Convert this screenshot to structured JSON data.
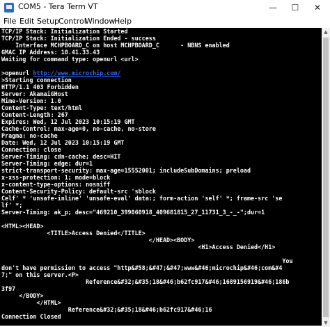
{
  "window": {
    "title": "COM5 - Tera Term VT",
    "minimize_glyph": "—",
    "maximize_glyph": "☐",
    "close_glyph": "✕"
  },
  "menu": {
    "items": [
      "File",
      "Edit",
      "Setup",
      "Control",
      "Window",
      "Help"
    ]
  },
  "terminal": {
    "lines": [
      "TCP/IP Stack: Initialization Started",
      "TCP/IP Stack: Initialization Ended - success",
      "    Interface MCHPBOARD_C on host MCHPBOARD_C      - NBNS enabled",
      "GMAC IP Address: 10.41.33.43",
      "Waiting for command type: openurl <url>",
      "",
      ">openurl http://www.microchip.com/",
      ">Starting connection",
      "HTTP/1.1 403 Forbidden",
      "Server: AkamaiGHost",
      "Mime-Version: 1.0",
      "Content-Type: text/html",
      "Content-Length: 267",
      "Expires: Wed, 12 Jul 2023 10:15:19 GMT",
      "Cache-Control: max-age=0, no-cache, no-store",
      "Pragma: no-cache",
      "Date: Wed, 12 Jul 2023 10:15:19 GMT",
      "Connection: close",
      "Server-Timing: cdn-cache; desc=HIT",
      "Server-Timing: edge; dur=1",
      "strict-transport-security: max-age=15552001; includeSubDomains; preload",
      "x-xss-protection: 1; mode=block",
      "x-content-type-options: nosniff",
      "Content-Security-Policy: default-src 'sblock",
      "Celf' * 'unsafe-inline' 'unsafe-eval' data:; form-action 'self' *; frame-src 'se",
      "lf' *;",
      "Server-Timing: ak_p; desc=\"469210_399060918_409681815_27_11731_3_-_-\";dur=1",
      "",
      "<HTML><HEAD>",
      "             <TITLE>Access Denied</TITLE>",
      "                                          </HEAD><BODY>",
      "                                                        <H1>Access Denied</H1>",
      "",
      "                                                                                You",
      "don't have permission to access \"http&#58;&#47;&#47;www&#46;microchip&#46;com&#4",
      "7;\" on this server.<P>",
      "                        Reference&#32;&#35;18&#46;b62fc917&#46;1689156919&#46;186b",
      "3f97",
      "     </BODY>",
      "          </HTML>",
      "                   Reference&#32;&#35;18&#46;b62fc917&#46;16",
      "Connection Closed"
    ],
    "link_text": "http://www.microchip.com/",
    "link_line_index": 6
  },
  "colors": {
    "terminal_bg": "#000000",
    "terminal_fg": "#ffffff",
    "link": "#2f6bff",
    "titlebar_bg": "#ffffff"
  }
}
